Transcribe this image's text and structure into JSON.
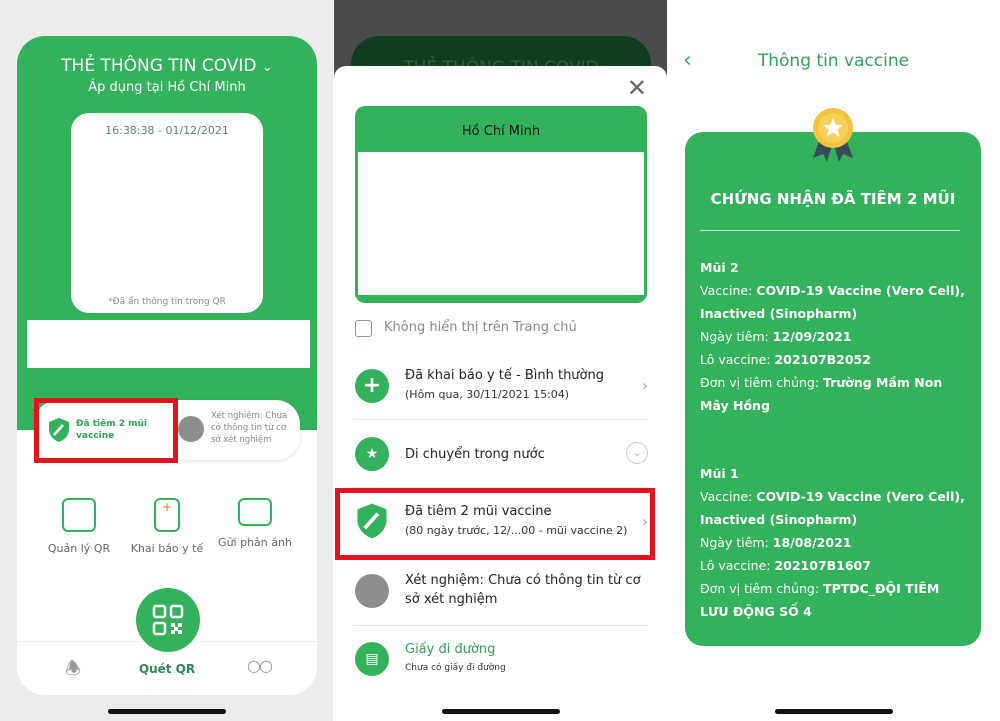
{
  "panel1": {
    "title": "THẺ THÔNG TIN COVID",
    "subtitle": "Áp dụng tại Hồ Chí Minh",
    "timestamp": "16:38:38 - 01/12/2021",
    "qr_note": "*Đã ẩn thông tin trong QR",
    "vaccine_status": "Đã tiêm 2 mũi vaccine",
    "test_status": "Xét nghiệm: Chưa có thông tin từ cơ sở xét nghiệm",
    "features": [
      {
        "label": "Quản lý QR"
      },
      {
        "label": "Khai báo y tế"
      },
      {
        "label": "Gửi phản ánh"
      }
    ],
    "nav": {
      "scan": "Quét QR"
    }
  },
  "panel2": {
    "bg_title": "THẺ THÔNG TIN COVID",
    "card_title": "Hồ Chí Minh",
    "checkbox_label": "Không hiển thị trên Trang chủ",
    "rows": [
      {
        "title": "Đã khai báo y tế - Bình thường",
        "sub": "(Hôm qua, 30/11/2021 15:04)"
      },
      {
        "title": "Di chuyển trong nước"
      },
      {
        "title": "Đã tiêm 2 mũi vaccine",
        "sub": "(80 ngày trước, 12/...00 - mũi vaccine 2)"
      },
      {
        "title": "Xét nghiệm: Chưa có thông tin từ cơ sở xét nghiệm"
      },
      {
        "title": "Giấy đi đường",
        "sub": "Chưa có giấy đi đường"
      }
    ]
  },
  "panel3": {
    "header": "Thông tin vaccine",
    "cert_title": "CHỨNG NHẬN ĐÃ TIÊM 2 MŨI",
    "labels": {
      "vaccine": "Vaccine: ",
      "date": "Ngày tiêm: ",
      "lot": "Lô vaccine: ",
      "unit": "Đơn vị tiêm chủng: "
    },
    "doses": [
      {
        "name": "Mũi 2",
        "vaccine": "COVID-19 Vaccine (Vero Cell), Inactived (Sinopharm)",
        "date": "12/09/2021",
        "lot": "202107B2052",
        "unit": "Trường Mầm Non Mây Hồng"
      },
      {
        "name": "Mũi 1",
        "vaccine": "COVID-19 Vaccine (Vero Cell), Inactived (Sinopharm)",
        "date": "18/08/2021",
        "lot": "202107B1607",
        "unit": "TPTDC_ĐỘI TIÊM LƯU ĐỘNG SỐ 4"
      }
    ]
  },
  "colors": {
    "brand": "#34b25b",
    "highlight": "#e0141e"
  }
}
